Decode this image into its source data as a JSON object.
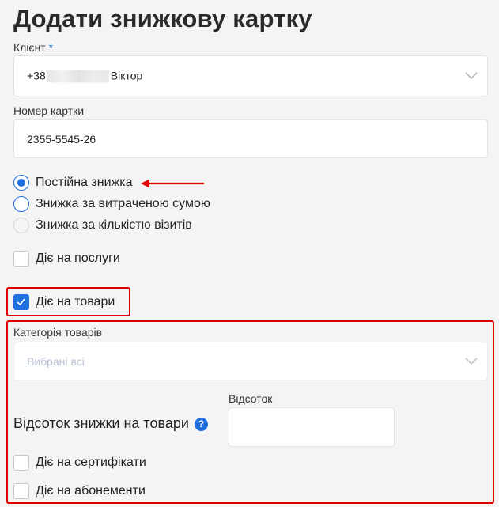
{
  "page": {
    "title": "Додати знижкову картку"
  },
  "client": {
    "label": "Клієнт",
    "required_mark": "*",
    "value_prefix": "+38",
    "value_name": "Віктор"
  },
  "card_number": {
    "label": "Номер картки",
    "value": "2355-5545-26"
  },
  "discount_type": {
    "options": [
      {
        "label": "Постійна знижка",
        "checked": true
      },
      {
        "label": "Знижка за витраченою сумою",
        "checked": false
      },
      {
        "label": "Знижка за кількістю візитів",
        "checked": false,
        "disabled": true
      }
    ]
  },
  "applies": {
    "services_label": "Діє на послуги",
    "services_checked": false,
    "goods_label": "Діє на товари",
    "goods_checked": true
  },
  "goods_section": {
    "category_label": "Категорія товарів",
    "category_placeholder": "Вибрані всі",
    "discount_label": "Відсоток знижки на товари",
    "percent_label": "Відсоток",
    "percent_value": "",
    "certificates_label": "Діє на сертифікати",
    "subscriptions_label": "Діє на абонементи"
  },
  "colors": {
    "accent": "#1f6fe0",
    "highlight": "#e00000"
  }
}
